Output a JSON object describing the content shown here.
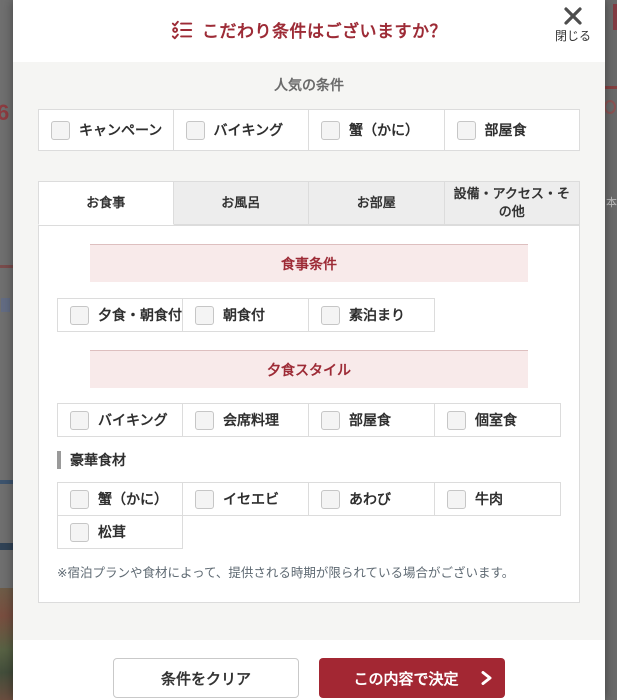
{
  "modal": {
    "title": "こだわり条件はございますか？",
    "close_label": "閉じる",
    "popular": {
      "heading": "人気の条件",
      "items": [
        "キャンペーン",
        "バイキング",
        "蟹（かに）",
        "部屋食"
      ]
    },
    "tabs": [
      {
        "label": "お食事",
        "active": true
      },
      {
        "label": "お風呂",
        "active": false
      },
      {
        "label": "お部屋",
        "active": false
      },
      {
        "label": "設備・アクセス・その他",
        "active": false
      }
    ],
    "meal_tab": {
      "sections": [
        {
          "heading": "食事条件",
          "items": [
            "夕食・朝食付",
            "朝食付",
            "素泊まり"
          ]
        },
        {
          "heading": "夕食スタイル",
          "items": [
            "バイキング",
            "会席料理",
            "部屋食",
            "個室食"
          ]
        }
      ],
      "luxury": {
        "heading": "豪華食材",
        "items": [
          "蟹（かに）",
          "イセエビ",
          "あわび",
          "牛肉",
          "松茸"
        ]
      },
      "note": "※宿泊プランや食材によって、提供される時期が限られている場合がございます。"
    },
    "footer": {
      "clear_label": "条件をクリア",
      "submit_label": "この内容で決定"
    }
  },
  "backdrop": {
    "left_fragment_text": "6",
    "right_fragment_text": "本"
  },
  "colors": {
    "accent_red": "#9d2b36",
    "submit_red": "#a32733",
    "banner_pink": "#f8eaea",
    "body_gray": "#f5f5f3",
    "border_gray": "#dcdcdc"
  }
}
